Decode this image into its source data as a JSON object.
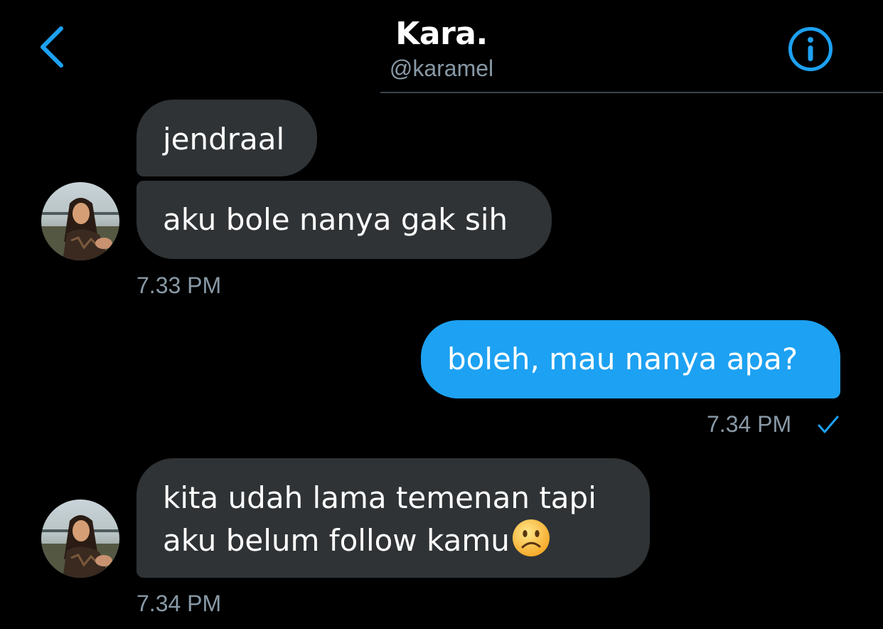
{
  "header": {
    "title": "Kara.",
    "handle": "@karamel",
    "back_icon": "chevron-left-icon",
    "info_icon": "info-circle-icon"
  },
  "colors": {
    "accent": "#1da1f2",
    "incoming_bubble": "#2f3336",
    "muted_text": "#8899a6",
    "background": "#000000"
  },
  "messages": [
    {
      "direction": "incoming",
      "text": "jendraal"
    },
    {
      "direction": "incoming",
      "text": "aku bole nanya gak sih",
      "timestamp": "7.33 PM"
    },
    {
      "direction": "outgoing",
      "text": "boleh, mau nanya apa?",
      "timestamp": "7.34 PM",
      "status_icon": "checkmark-icon"
    },
    {
      "direction": "incoming",
      "lines": [
        "kita udah lama temenan tapi",
        "aku belum follow kamu"
      ],
      "emoji": "slightly-frowning-face",
      "timestamp": "7.34 PM"
    }
  ]
}
